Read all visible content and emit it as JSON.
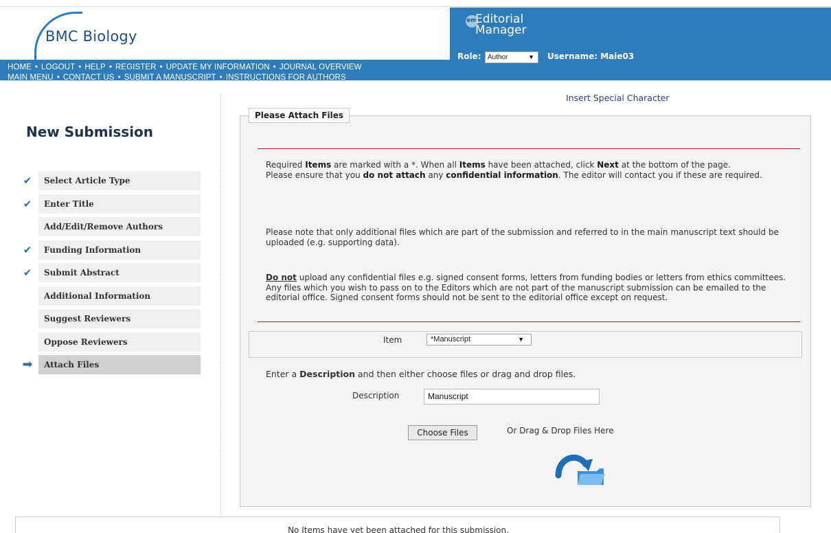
{
  "header": {
    "brand": "BMC Biology",
    "nav_row1": [
      "HOME",
      "LOGOUT",
      "HELP",
      "REGISTER",
      "UPDATE MY INFORMATION",
      "JOURNAL OVERVIEW"
    ],
    "nav_row2": [
      "MAIN MENU",
      "CONTACT US",
      "SUBMIT A MANUSCRIPT",
      "INSTRUCTIONS FOR AUTHORS"
    ],
    "em_badge": "em",
    "em_title_line1": "Editorial",
    "em_title_line2": "Manager",
    "role_label": "Role:",
    "role_value": "Author",
    "username": "Username: Maie03"
  },
  "sidebar": {
    "title": "New Submission",
    "steps": [
      {
        "label": "Select Article Type",
        "status": "done"
      },
      {
        "label": "Enter Title",
        "status": "done"
      },
      {
        "label": "Add/Edit/Remove Authors",
        "status": "none"
      },
      {
        "label": "Funding Information",
        "status": "done"
      },
      {
        "label": "Submit Abstract",
        "status": "done"
      },
      {
        "label": "Additional Information",
        "status": "none"
      },
      {
        "label": "Suggest Reviewers",
        "status": "none"
      },
      {
        "label": "Oppose Reviewers",
        "status": "none"
      },
      {
        "label": "Attach Files",
        "status": "current"
      }
    ]
  },
  "main": {
    "special_char_link": "Insert Special Character",
    "section_title": "Please Attach Files",
    "item_label": "Item",
    "item_value": "*Manuscript",
    "enter_desc_pre": "Enter a ",
    "enter_desc_bold": "Description",
    "enter_desc_post": " and then either choose files or drag and drop files.",
    "description_label": "Description",
    "description_value": "Manuscript",
    "choose_files": "Choose Files",
    "drag_drop_text": "Or Drag & Drop Files Here",
    "status_text": "No Items have yet been attached for this submission."
  },
  "icons": {
    "check": "check-icon",
    "current": "arrow-right-icon",
    "drop": "folder-drop-icon"
  },
  "colors": {
    "header_blue": "#2f7cbd",
    "rule_red": "#a31f2a",
    "step_bg": "#efefef",
    "active_step_bg": "#cfcfcf"
  }
}
